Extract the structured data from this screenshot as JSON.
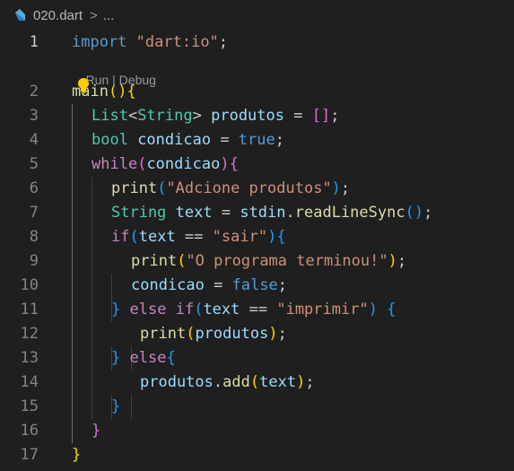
{
  "breadcrumb": {
    "file_name": "020.dart",
    "separator": ">",
    "more": "..."
  },
  "codelens": {
    "text": "Run | Debug",
    "run": "Run",
    "debug": "Debug"
  },
  "editor": {
    "lines": [
      {
        "num": "1",
        "tokens": [
          [
            "import",
            "kw"
          ],
          [
            " ",
            "pl"
          ],
          [
            "\"dart:io\"",
            "str"
          ],
          [
            ";",
            "pl"
          ]
        ]
      },
      {
        "num": "2",
        "tokens": [
          [
            "main",
            "fn"
          ],
          [
            "()",
            "b1"
          ],
          [
            "{",
            "b1"
          ]
        ]
      },
      {
        "num": "3",
        "tokens": [
          [
            "List",
            "typ"
          ],
          [
            "<",
            "pl"
          ],
          [
            "String",
            "typ"
          ],
          [
            ">",
            "pl"
          ],
          [
            " produtos",
            "var"
          ],
          [
            " = ",
            "pl"
          ],
          [
            "[]",
            "b2"
          ],
          [
            ";",
            "pl"
          ]
        ]
      },
      {
        "num": "4",
        "tokens": [
          [
            "bool",
            "typ"
          ],
          [
            " condicao",
            "var"
          ],
          [
            " = ",
            "pl"
          ],
          [
            "true",
            "kw"
          ],
          [
            ";",
            "pl"
          ]
        ]
      },
      {
        "num": "5",
        "tokens": [
          [
            "while",
            "ctl"
          ],
          [
            "(",
            "b2"
          ],
          [
            "condicao",
            "var"
          ],
          [
            ")",
            "b2"
          ],
          [
            "{",
            "b2"
          ]
        ]
      },
      {
        "num": "6",
        "tokens": [
          [
            "print",
            "fn"
          ],
          [
            "(",
            "b3"
          ],
          [
            "\"Adcione produtos\"",
            "str"
          ],
          [
            ")",
            "b3"
          ],
          [
            ";",
            "pl"
          ]
        ]
      },
      {
        "num": "7",
        "tokens": [
          [
            "String",
            "typ"
          ],
          [
            " text",
            "var"
          ],
          [
            " = ",
            "pl"
          ],
          [
            "stdin",
            "var"
          ],
          [
            ".",
            "pl"
          ],
          [
            "readLineSync",
            "fn"
          ],
          [
            "()",
            "b3"
          ],
          [
            ";",
            "pl"
          ]
        ]
      },
      {
        "num": "8",
        "tokens": [
          [
            "if",
            "ctl"
          ],
          [
            "(",
            "b3"
          ],
          [
            "text",
            "var"
          ],
          [
            " == ",
            "pl"
          ],
          [
            "\"sair\"",
            "str"
          ],
          [
            ")",
            "b3"
          ],
          [
            "{",
            "b3"
          ]
        ]
      },
      {
        "num": "9",
        "tokens": [
          [
            "print",
            "fn"
          ],
          [
            "(",
            "b1"
          ],
          [
            "\"O programa terminou!\"",
            "str"
          ],
          [
            ")",
            "b1"
          ],
          [
            ";",
            "pl"
          ]
        ]
      },
      {
        "num": "10",
        "tokens": [
          [
            "condicao",
            "var"
          ],
          [
            " = ",
            "pl"
          ],
          [
            "false",
            "kw"
          ],
          [
            ";",
            "pl"
          ]
        ]
      },
      {
        "num": "11",
        "tokens": [
          [
            "}",
            "b3"
          ],
          [
            " ",
            "pl"
          ],
          [
            "else",
            "ctl"
          ],
          [
            " ",
            "pl"
          ],
          [
            "if",
            "ctl"
          ],
          [
            "(",
            "b3"
          ],
          [
            "text",
            "var"
          ],
          [
            " == ",
            "pl"
          ],
          [
            "\"imprimir\"",
            "str"
          ],
          [
            ")",
            "b3"
          ],
          [
            " ",
            "pl"
          ],
          [
            "{",
            "b3"
          ]
        ]
      },
      {
        "num": "12",
        "tokens": [
          [
            "print",
            "fn"
          ],
          [
            "(",
            "b1"
          ],
          [
            "produtos",
            "var"
          ],
          [
            ")",
            "b1"
          ],
          [
            ";",
            "pl"
          ]
        ]
      },
      {
        "num": "13",
        "tokens": [
          [
            "}",
            "b3"
          ],
          [
            " ",
            "pl"
          ],
          [
            "else",
            "ctl"
          ],
          [
            "{",
            "b3"
          ]
        ]
      },
      {
        "num": "14",
        "tokens": [
          [
            "produtos",
            "var"
          ],
          [
            ".",
            "pl"
          ],
          [
            "add",
            "fn"
          ],
          [
            "(",
            "b1"
          ],
          [
            "text",
            "var"
          ],
          [
            ")",
            "b1"
          ],
          [
            ";",
            "pl"
          ]
        ]
      },
      {
        "num": "15",
        "tokens": [
          [
            "}",
            "b3"
          ]
        ]
      },
      {
        "num": "16",
        "tokens": [
          [
            "}",
            "b2"
          ]
        ]
      },
      {
        "num": "17",
        "tokens": [
          [
            "}",
            "b1"
          ]
        ]
      }
    ]
  },
  "icons": {
    "file": "dart-file-icon",
    "lightbulb": "lightbulb-icon"
  },
  "colors": {
    "background": "#1f1f1f",
    "keyword": "#569cd6",
    "control": "#c586c0",
    "string": "#ce9178",
    "type": "#4ec9b0",
    "variable": "#9cdcfe",
    "function": "#dcdcaa",
    "bracket_1": "#ffd700",
    "bracket_2": "#da70d6",
    "bracket_3": "#179fff",
    "lightbulb": "#ffcc00"
  }
}
